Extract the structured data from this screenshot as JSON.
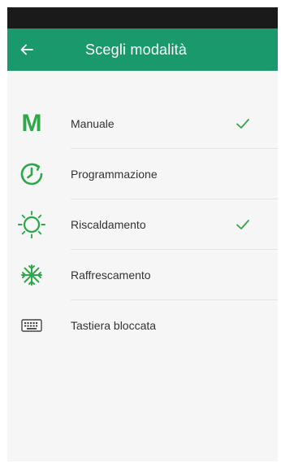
{
  "header": {
    "title": "Scegli modalità",
    "back_icon": "arrow-left-icon",
    "color": "#1a9a6c"
  },
  "accent_color": "#2ea84a",
  "modes": [
    {
      "label": "Manuale",
      "icon": "manual-m-icon",
      "icon_text": "M",
      "selected": true
    },
    {
      "label": "Programmazione",
      "icon": "clock-schedule-icon",
      "selected": false
    },
    {
      "label": "Riscaldamento",
      "icon": "sun-heating-icon",
      "selected": true
    },
    {
      "label": "Raffrescamento",
      "icon": "snowflake-cooling-icon",
      "selected": false
    },
    {
      "label": "Tastiera bloccata",
      "icon": "keyboard-lock-icon",
      "selected": false
    }
  ]
}
